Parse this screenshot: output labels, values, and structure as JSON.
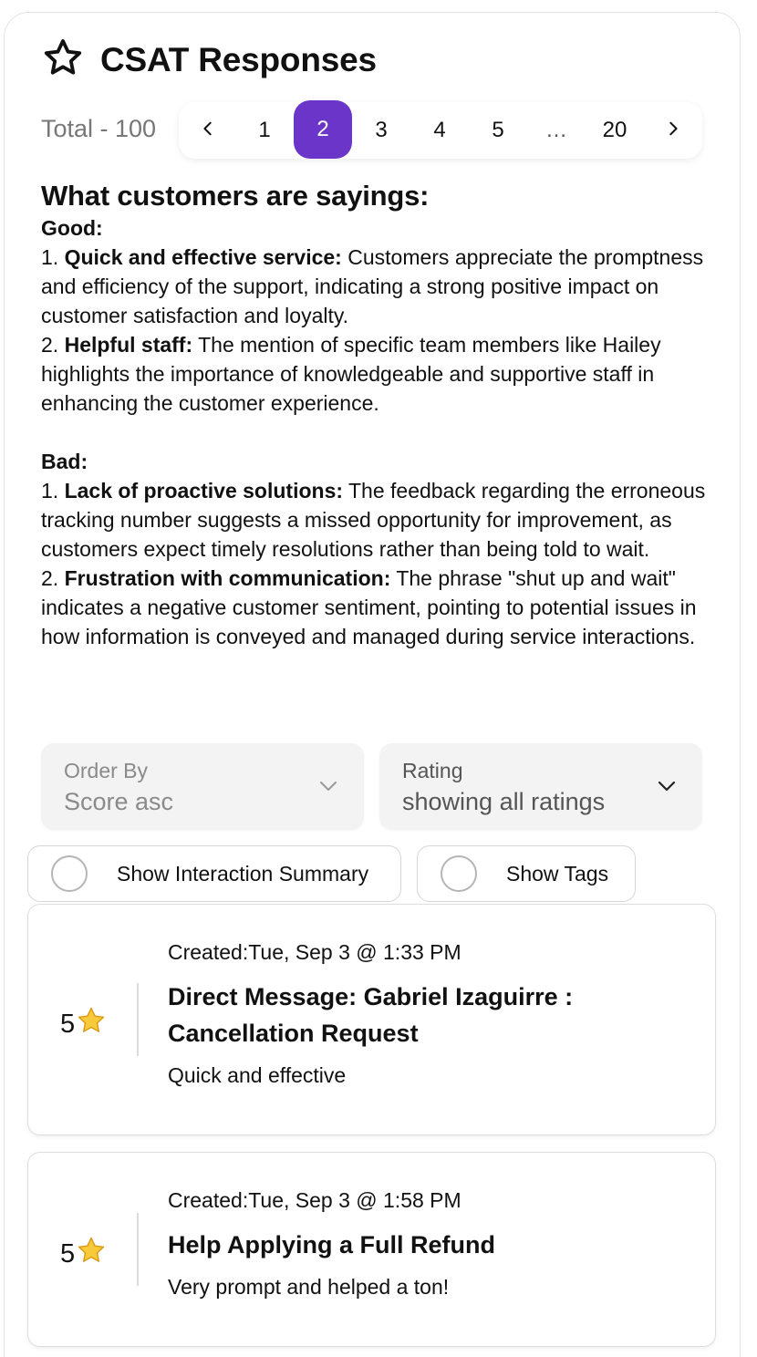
{
  "header": {
    "title": "CSAT Responses",
    "icon": "star-outline-icon"
  },
  "pagination": {
    "total_label": "Total - 100",
    "prev": "‹",
    "next": "›",
    "pages": [
      "1",
      "2",
      "3",
      "4",
      "5",
      "…",
      "20"
    ],
    "active_page": "2",
    "accent_color": "#6c35c9"
  },
  "summary": {
    "heading": "What customers are sayings:",
    "good_label": "Good:",
    "good_items": [
      {
        "num": "1. ",
        "title": "Quick and effective service:",
        "text": " Customers appreciate the promptness and efficiency of the support, indicating a strong positive impact on customer satisfaction and loyalty."
      },
      {
        "num": "2. ",
        "title": "Helpful staff:",
        "text": " The mention of specific team members like Hailey highlights the importance of knowledgeable and supportive staff in enhancing the customer experience."
      }
    ],
    "bad_label": "Bad:",
    "bad_items": [
      {
        "num": "1. ",
        "title": "Lack of proactive solutions:",
        "text": " The feedback regarding the erroneous tracking number suggests a missed opportunity for improvement, as customers expect timely resolutions rather than being told to wait."
      },
      {
        "num": "2. ",
        "title": "Frustration with communication:",
        "text": " The phrase \"shut up and wait\" indicates a negative customer sentiment, pointing to potential issues in how information is conveyed and managed during service interactions."
      }
    ]
  },
  "filters": {
    "order_by": {
      "label": "Order By",
      "value": "Score asc"
    },
    "rating": {
      "label": "Rating",
      "value": "showing all ratings"
    }
  },
  "toggles": {
    "interaction_summary": {
      "label": "Show Interaction Summary",
      "checked": false
    },
    "tags": {
      "label": "Show Tags",
      "checked": false
    }
  },
  "responses": [
    {
      "score": "5",
      "created": "Created:Tue, Sep 3 @ 1:33 PM",
      "title": "Direct Message: Gabriel Izaguirre : Cancellation Request",
      "comment": "Quick and effective"
    },
    {
      "score": "5",
      "created": "Created:Tue, Sep 3 @ 1:58 PM",
      "title": "Help Applying a Full Refund",
      "comment": "Very prompt and helped a ton!"
    }
  ]
}
